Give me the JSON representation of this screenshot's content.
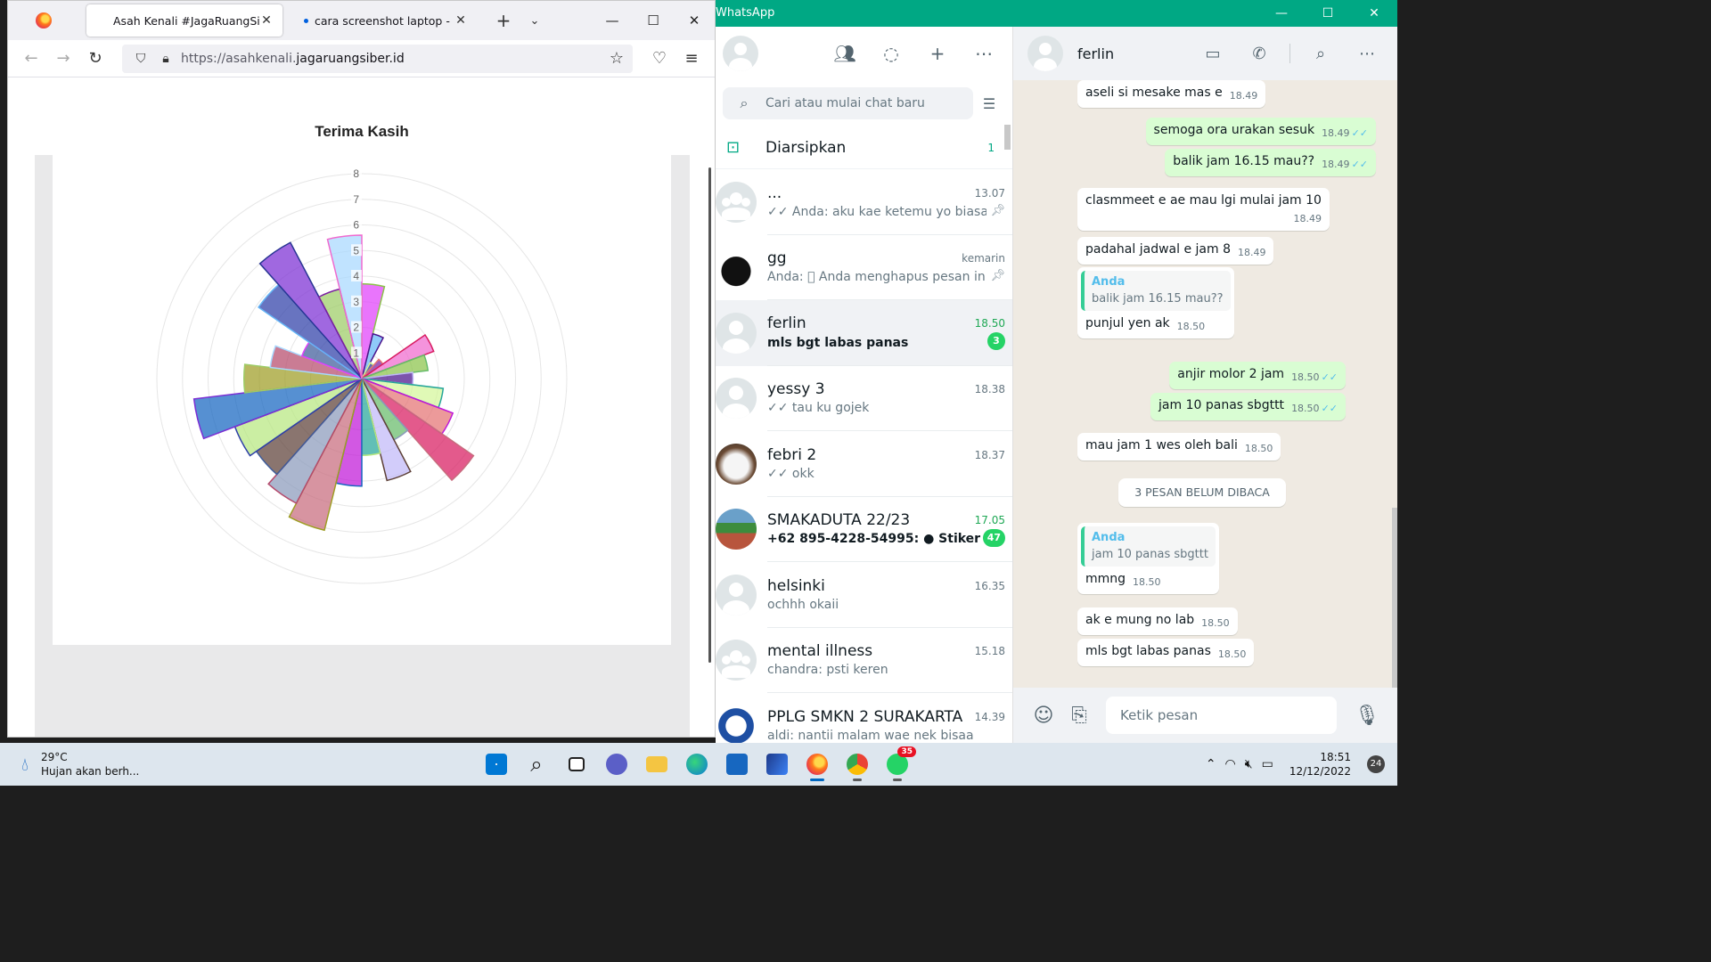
{
  "firefox": {
    "tabs": [
      {
        "title": "Asah Kenali #JagaRuangSiber",
        "active": true
      },
      {
        "title": "cara screenshot laptop - Peneli",
        "active": false
      }
    ],
    "url_prefix": "https://asahkenali.",
    "url_domain": "jagaruangsiber.id"
  },
  "chart_data": {
    "type": "polar-area",
    "title": "Terima Kasih",
    "rmax": 8,
    "tick_labels": [
      "1",
      "2",
      "3",
      "4",
      "5",
      "6",
      "7",
      "8"
    ],
    "values": [
      3.7,
      1.8,
      0.7,
      1.0,
      3.0,
      2.6,
      2.0,
      3.2,
      3.8,
      5.3,
      2.7,
      4.1,
      3.0,
      4.2,
      6.1,
      5.5,
      5.0,
      5.3,
      6.6,
      4.6,
      3.6,
      2.5,
      4.9,
      6.0,
      3.6,
      5.6
    ],
    "colors": [
      "#e040fb",
      "#64b5f6",
      "#283593",
      "#7b1fa2",
      "#f06acf",
      "#8bc34a",
      "#4a148c",
      "#d4f79a",
      "#e57373",
      "#d81b60",
      "#66bb6a",
      "#c0b8f8",
      "#26a69a",
      "#c018d8",
      "#c86b7d",
      "#8a9abb",
      "#5d4037",
      "#b7e87f",
      "#1565c0",
      "#9e9d24",
      "#b5496b",
      "#3e5c9a",
      "#2e3fa8",
      "#7b2ed4",
      "#9ccc65",
      "#a8d8ff"
    ]
  },
  "whatsapp": {
    "app_title": "WhatsApp",
    "search_placeholder": "Cari atau mulai chat baru",
    "archived_label": "Diarsipkan",
    "archived_count": "1",
    "chats": [
      {
        "name": "...",
        "time": "13.07",
        "preview": "✓✓ Anda: aku kae ketemu yo biasa...",
        "pinned": true,
        "unread": "",
        "selected": false,
        "avatar": "grp"
      },
      {
        "name": "gg",
        "time": "kemarin",
        "preview": "Anda: ⃠ Anda menghapus pesan ini",
        "pinned": true,
        "unread": "",
        "selected": false,
        "avatar": "img-gg"
      },
      {
        "name": "ferlin",
        "time": "18.50",
        "preview": "mls bgt labas panas",
        "pinned": false,
        "unread": "3",
        "selected": true,
        "avatar": "gen"
      },
      {
        "name": "yessy 3",
        "time": "18.38",
        "preview": "✓✓ tau ku gojek",
        "pinned": false,
        "unread": "",
        "selected": false,
        "avatar": "gen"
      },
      {
        "name": "febri 2",
        "time": "18.37",
        "preview": "✓✓ okk",
        "pinned": false,
        "unread": "",
        "selected": false,
        "avatar": "img-febri"
      },
      {
        "name": "SMAKADUTA 22/23",
        "time": "17.05",
        "preview": "+62 895-4228-54995: ● Stiker",
        "pinned": false,
        "unread": "47",
        "selected": false,
        "avatar": "img-smk"
      },
      {
        "name": "helsinki",
        "time": "16.35",
        "preview": "ochhh okaii",
        "pinned": false,
        "unread": "",
        "selected": false,
        "avatar": "gen"
      },
      {
        "name": "mental illness",
        "time": "15.18",
        "preview": "chandra: psti keren",
        "pinned": false,
        "unread": "",
        "selected": false,
        "avatar": "grp"
      },
      {
        "name": "PPLG SMKN 2 SURAKARTA",
        "time": "14.39",
        "preview": "aldi: nantii malam wae nek bisaa",
        "pinned": false,
        "unread": "",
        "selected": false,
        "avatar": "img-pplg"
      }
    ],
    "contact": "ferlin",
    "messages": [
      {
        "dir": "in",
        "text": "aseli si mesake mas e",
        "time": "18.49"
      },
      {
        "dir": "out",
        "text": "semoga ora urakan sesuk",
        "time": "18.49"
      },
      {
        "dir": "out",
        "text": "balik jam 16.15 mau??",
        "time": "18.49"
      },
      {
        "dir": "in",
        "text": "clasmmeet e ae mau lgi mulai jam 10",
        "time": "18.49"
      },
      {
        "dir": "in",
        "text": "padahal jadwal e jam 8",
        "time": "18.49"
      },
      {
        "dir": "in",
        "text": "punjul yen ak",
        "time": "18.50",
        "quote_name": "Anda",
        "quote_text": "balik jam 16.15 mau??"
      },
      {
        "dir": "out",
        "text": "anjir molor 2 jam",
        "time": "18.50"
      },
      {
        "dir": "out",
        "text": "jam 10 panas sbgttt",
        "time": "18.50"
      },
      {
        "dir": "in",
        "text": "mau jam 1 wes oleh bali",
        "time": "18.50"
      },
      {
        "dir": "in",
        "text": "mmng",
        "time": "18.50",
        "quote_name": "Anda",
        "quote_text": "jam 10 panas sbgttt"
      },
      {
        "dir": "in",
        "text": "ak e mung no lab",
        "time": "18.50"
      },
      {
        "dir": "in",
        "text": "mls bgt labas panas",
        "time": "18.50"
      }
    ],
    "unread_divider": "3 PESAN BELUM DIBACA",
    "input_placeholder": "Ketik pesan"
  },
  "taskbar": {
    "temp": "29°C",
    "weather": "Hujan akan berh...",
    "time": "18:51",
    "date": "12/12/2022",
    "notifications": "24",
    "whatsapp_badge": "35"
  }
}
